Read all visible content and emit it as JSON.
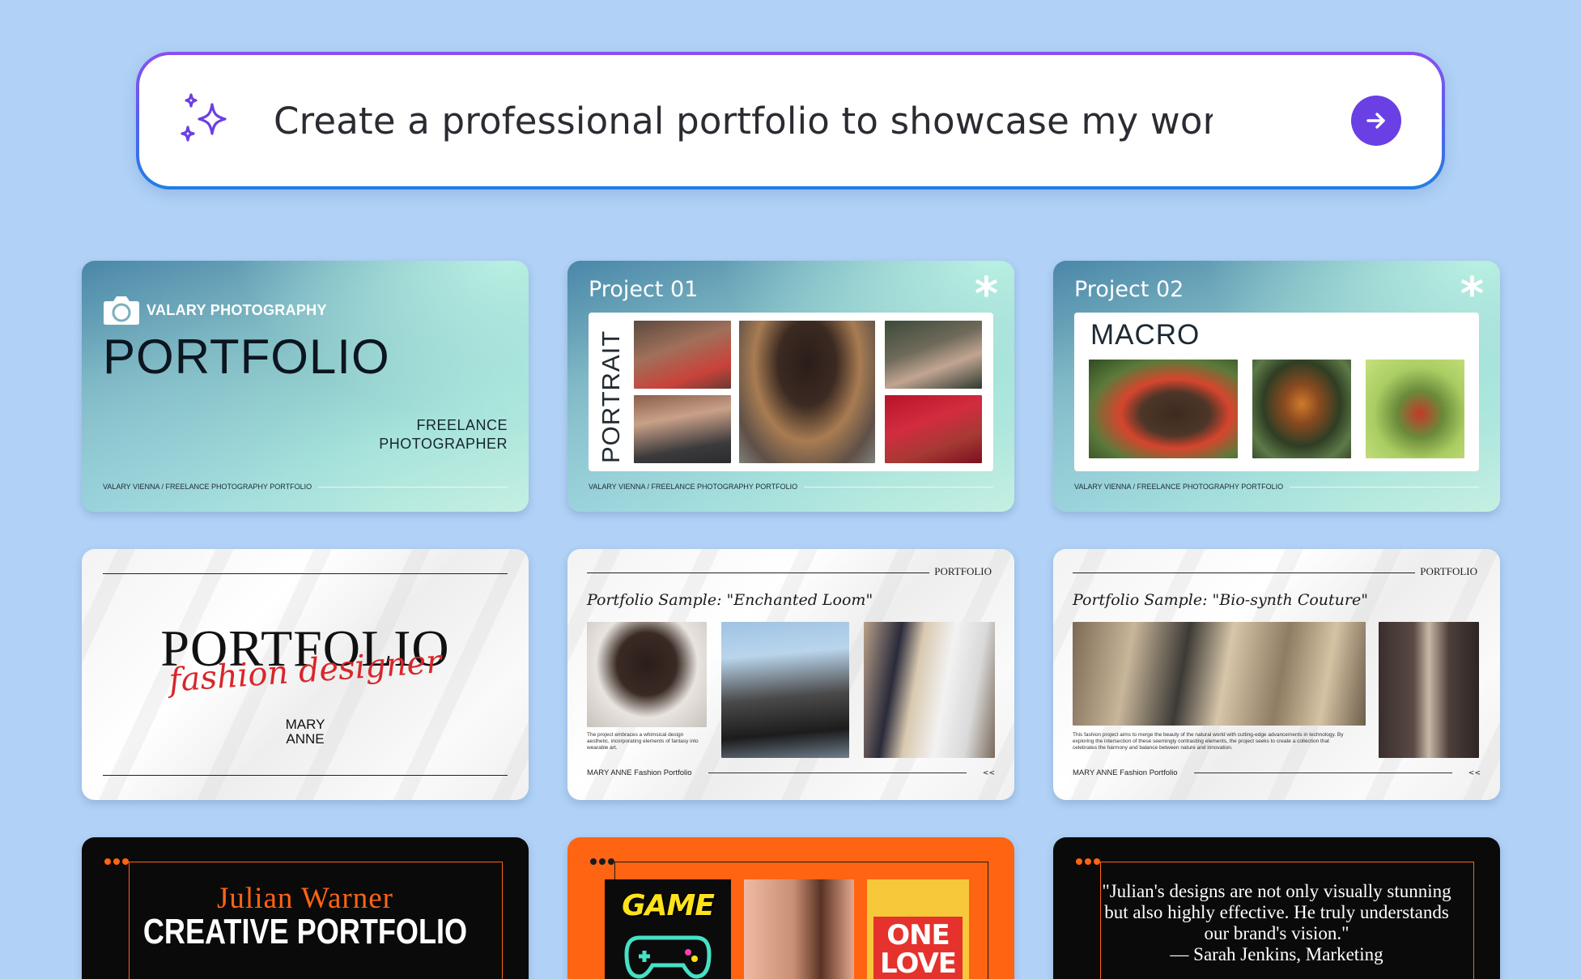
{
  "prompt": {
    "placeholder": "Create a professional portfolio to showcase my work...",
    "icon": "sparkle-icon",
    "send_icon": "arrow-right-icon",
    "accent": "#6a3fe4"
  },
  "cards": {
    "photo_cover": {
      "brand": "VALARY PHOTOGRAPHY",
      "title": "PORTFOLIO",
      "subtitle_line1": "FREELANCE",
      "subtitle_line2": "PHOTOGRAPHER",
      "footer": "VALARY VIENNA / FREELANCE PHOTOGRAPHY PORTFOLIO"
    },
    "project_01": {
      "title": "Project 01",
      "asterisk": "*",
      "label": "PORTRAIT",
      "footer": "VALARY VIENNA / FREELANCE PHOTOGRAPHY PORTFOLIO"
    },
    "project_02": {
      "title": "Project 02",
      "asterisk": "*",
      "label": "MACRO",
      "footer": "VALARY VIENNA / FREELANCE PHOTOGRAPHY PORTFOLIO"
    },
    "fashion_cover": {
      "title": "PORTFOLIO",
      "script": "fashion designer",
      "name_line1": "MARY",
      "name_line2": "ANNE"
    },
    "enchanted_loom": {
      "logo": "PORTFOLIO",
      "title": "Portfolio Sample: \"Enchanted Loom\"",
      "caption": "The project embraces a whimsical design aesthetic, incorporating elements of fantasy into wearable art.",
      "footer": "MARY ANNE Fashion Portfolio",
      "footer_mark": "<<"
    },
    "biosynth_couture": {
      "logo": "PORTFOLIO",
      "title": "Portfolio Sample: \"Bio-synth Couture\"",
      "caption": "This fashion project aims to merge the beauty of the natural world with cutting-edge advancements in technology. By exploring the intersection of these seemingly contrasting elements, the project seeks to create a collection that celebrates the harmony and balance between nature and innovation.",
      "footer": "MARY ANNE Fashion Portfolio",
      "footer_mark": "<<"
    },
    "julian_cover": {
      "name": "Julian Warner",
      "title": "CREATIVE PORTFOLIO"
    },
    "julian_posters": {
      "poster1": "GAME",
      "poster3_line1": "ONE",
      "poster3_line2": "LOVE"
    },
    "julian_quote": {
      "quote": "\"Julian's designs are not only visually stunning but also highly effective. He truly understands our brand's vision.\"",
      "attribution": "— Sarah Jenkins, Marketing"
    }
  },
  "colors": {
    "background": "#b1d2f6",
    "orange": "#ff6412",
    "script_red": "#d9262b"
  }
}
